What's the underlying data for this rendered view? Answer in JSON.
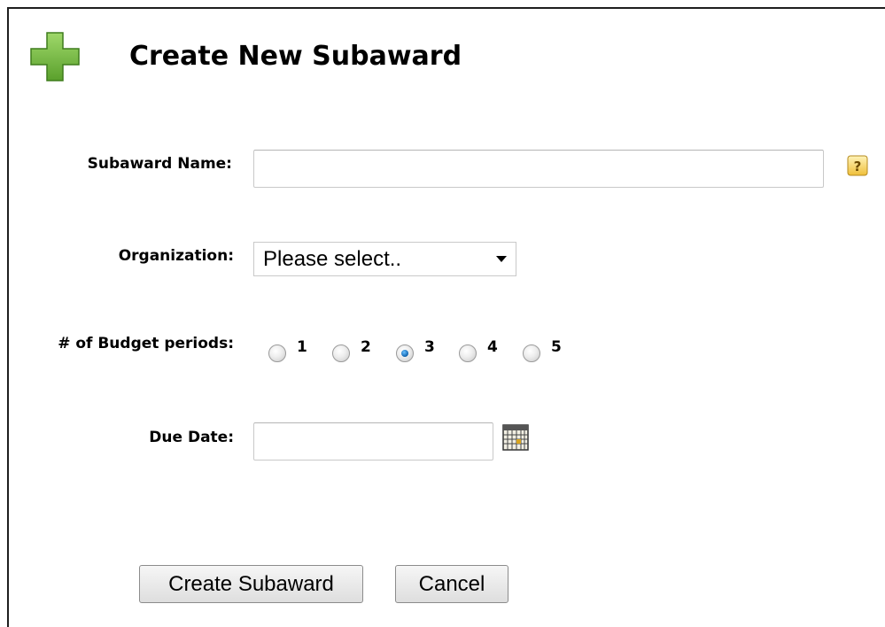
{
  "header": {
    "title": "Create New Subaward",
    "icon": "plus-icon"
  },
  "form": {
    "subaward_name": {
      "label": "Subaward Name:",
      "value": "",
      "placeholder": "",
      "help_icon": "help-icon"
    },
    "organization": {
      "label": "Organization:",
      "selected": "Please select.."
    },
    "budget_periods": {
      "label": "# of Budget periods:",
      "options": [
        "1",
        "2",
        "3",
        "4",
        "5"
      ],
      "selected": "3"
    },
    "due_date": {
      "label": "Due Date:",
      "value": "",
      "calendar_icon": "calendar-icon"
    }
  },
  "actions": {
    "create_label": "Create Subaward",
    "cancel_label": "Cancel"
  },
  "colors": {
    "icon_green": "#6fb83a",
    "help_yellow": "#f3c64b",
    "radio_selected": "#1a6fb9"
  }
}
